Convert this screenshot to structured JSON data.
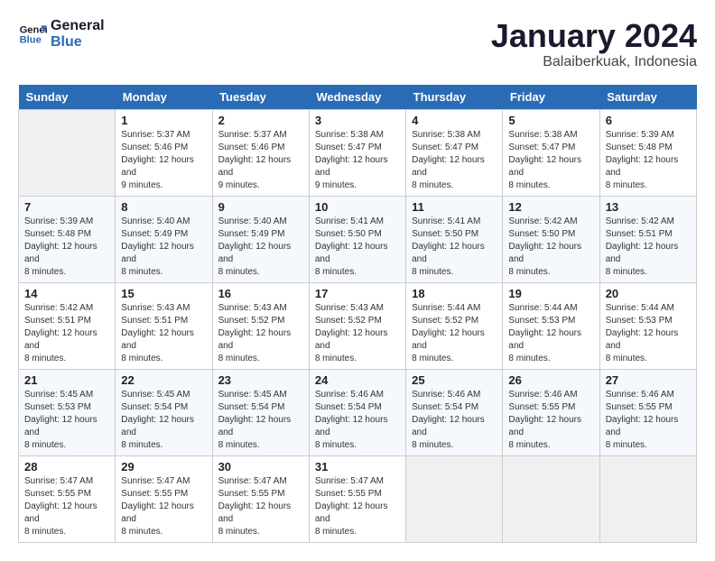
{
  "header": {
    "logo_line1": "General",
    "logo_line2": "Blue",
    "title": "January 2024",
    "subtitle": "Balaiberkuak, Indonesia"
  },
  "days_of_week": [
    "Sunday",
    "Monday",
    "Tuesday",
    "Wednesday",
    "Thursday",
    "Friday",
    "Saturday"
  ],
  "weeks": [
    [
      {
        "day": "",
        "sunrise": "",
        "sunset": "",
        "daylight": ""
      },
      {
        "day": "1",
        "sunrise": "Sunrise: 5:37 AM",
        "sunset": "Sunset: 5:46 PM",
        "daylight": "Daylight: 12 hours and 9 minutes."
      },
      {
        "day": "2",
        "sunrise": "Sunrise: 5:37 AM",
        "sunset": "Sunset: 5:46 PM",
        "daylight": "Daylight: 12 hours and 9 minutes."
      },
      {
        "day": "3",
        "sunrise": "Sunrise: 5:38 AM",
        "sunset": "Sunset: 5:47 PM",
        "daylight": "Daylight: 12 hours and 9 minutes."
      },
      {
        "day": "4",
        "sunrise": "Sunrise: 5:38 AM",
        "sunset": "Sunset: 5:47 PM",
        "daylight": "Daylight: 12 hours and 8 minutes."
      },
      {
        "day": "5",
        "sunrise": "Sunrise: 5:38 AM",
        "sunset": "Sunset: 5:47 PM",
        "daylight": "Daylight: 12 hours and 8 minutes."
      },
      {
        "day": "6",
        "sunrise": "Sunrise: 5:39 AM",
        "sunset": "Sunset: 5:48 PM",
        "daylight": "Daylight: 12 hours and 8 minutes."
      }
    ],
    [
      {
        "day": "7",
        "sunrise": "Sunrise: 5:39 AM",
        "sunset": "Sunset: 5:48 PM",
        "daylight": "Daylight: 12 hours and 8 minutes."
      },
      {
        "day": "8",
        "sunrise": "Sunrise: 5:40 AM",
        "sunset": "Sunset: 5:49 PM",
        "daylight": "Daylight: 12 hours and 8 minutes."
      },
      {
        "day": "9",
        "sunrise": "Sunrise: 5:40 AM",
        "sunset": "Sunset: 5:49 PM",
        "daylight": "Daylight: 12 hours and 8 minutes."
      },
      {
        "day": "10",
        "sunrise": "Sunrise: 5:41 AM",
        "sunset": "Sunset: 5:50 PM",
        "daylight": "Daylight: 12 hours and 8 minutes."
      },
      {
        "day": "11",
        "sunrise": "Sunrise: 5:41 AM",
        "sunset": "Sunset: 5:50 PM",
        "daylight": "Daylight: 12 hours and 8 minutes."
      },
      {
        "day": "12",
        "sunrise": "Sunrise: 5:42 AM",
        "sunset": "Sunset: 5:50 PM",
        "daylight": "Daylight: 12 hours and 8 minutes."
      },
      {
        "day": "13",
        "sunrise": "Sunrise: 5:42 AM",
        "sunset": "Sunset: 5:51 PM",
        "daylight": "Daylight: 12 hours and 8 minutes."
      }
    ],
    [
      {
        "day": "14",
        "sunrise": "Sunrise: 5:42 AM",
        "sunset": "Sunset: 5:51 PM",
        "daylight": "Daylight: 12 hours and 8 minutes."
      },
      {
        "day": "15",
        "sunrise": "Sunrise: 5:43 AM",
        "sunset": "Sunset: 5:51 PM",
        "daylight": "Daylight: 12 hours and 8 minutes."
      },
      {
        "day": "16",
        "sunrise": "Sunrise: 5:43 AM",
        "sunset": "Sunset: 5:52 PM",
        "daylight": "Daylight: 12 hours and 8 minutes."
      },
      {
        "day": "17",
        "sunrise": "Sunrise: 5:43 AM",
        "sunset": "Sunset: 5:52 PM",
        "daylight": "Daylight: 12 hours and 8 minutes."
      },
      {
        "day": "18",
        "sunrise": "Sunrise: 5:44 AM",
        "sunset": "Sunset: 5:52 PM",
        "daylight": "Daylight: 12 hours and 8 minutes."
      },
      {
        "day": "19",
        "sunrise": "Sunrise: 5:44 AM",
        "sunset": "Sunset: 5:53 PM",
        "daylight": "Daylight: 12 hours and 8 minutes."
      },
      {
        "day": "20",
        "sunrise": "Sunrise: 5:44 AM",
        "sunset": "Sunset: 5:53 PM",
        "daylight": "Daylight: 12 hours and 8 minutes."
      }
    ],
    [
      {
        "day": "21",
        "sunrise": "Sunrise: 5:45 AM",
        "sunset": "Sunset: 5:53 PM",
        "daylight": "Daylight: 12 hours and 8 minutes."
      },
      {
        "day": "22",
        "sunrise": "Sunrise: 5:45 AM",
        "sunset": "Sunset: 5:54 PM",
        "daylight": "Daylight: 12 hours and 8 minutes."
      },
      {
        "day": "23",
        "sunrise": "Sunrise: 5:45 AM",
        "sunset": "Sunset: 5:54 PM",
        "daylight": "Daylight: 12 hours and 8 minutes."
      },
      {
        "day": "24",
        "sunrise": "Sunrise: 5:46 AM",
        "sunset": "Sunset: 5:54 PM",
        "daylight": "Daylight: 12 hours and 8 minutes."
      },
      {
        "day": "25",
        "sunrise": "Sunrise: 5:46 AM",
        "sunset": "Sunset: 5:54 PM",
        "daylight": "Daylight: 12 hours and 8 minutes."
      },
      {
        "day": "26",
        "sunrise": "Sunrise: 5:46 AM",
        "sunset": "Sunset: 5:55 PM",
        "daylight": "Daylight: 12 hours and 8 minutes."
      },
      {
        "day": "27",
        "sunrise": "Sunrise: 5:46 AM",
        "sunset": "Sunset: 5:55 PM",
        "daylight": "Daylight: 12 hours and 8 minutes."
      }
    ],
    [
      {
        "day": "28",
        "sunrise": "Sunrise: 5:47 AM",
        "sunset": "Sunset: 5:55 PM",
        "daylight": "Daylight: 12 hours and 8 minutes."
      },
      {
        "day": "29",
        "sunrise": "Sunrise: 5:47 AM",
        "sunset": "Sunset: 5:55 PM",
        "daylight": "Daylight: 12 hours and 8 minutes."
      },
      {
        "day": "30",
        "sunrise": "Sunrise: 5:47 AM",
        "sunset": "Sunset: 5:55 PM",
        "daylight": "Daylight: 12 hours and 8 minutes."
      },
      {
        "day": "31",
        "sunrise": "Sunrise: 5:47 AM",
        "sunset": "Sunset: 5:55 PM",
        "daylight": "Daylight: 12 hours and 8 minutes."
      },
      {
        "day": "",
        "sunrise": "",
        "sunset": "",
        "daylight": ""
      },
      {
        "day": "",
        "sunrise": "",
        "sunset": "",
        "daylight": ""
      },
      {
        "day": "",
        "sunrise": "",
        "sunset": "",
        "daylight": ""
      }
    ]
  ]
}
